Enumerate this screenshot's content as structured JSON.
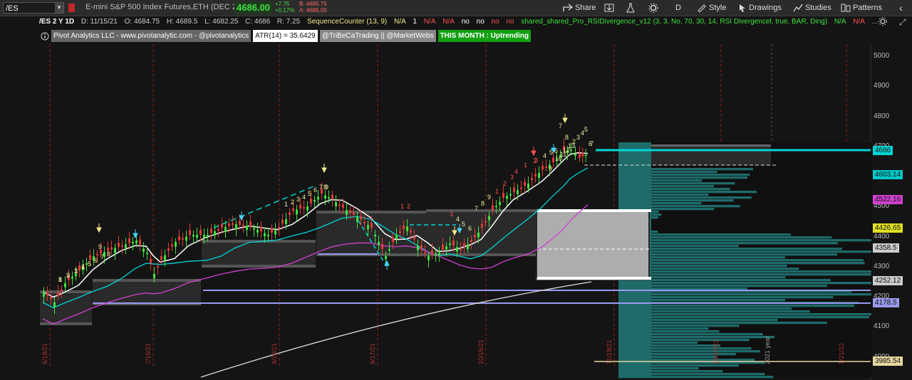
{
  "header": {
    "symbol": "/ES",
    "description": "E-mini S&P 500 Index Futures,ETH (DEC 21)",
    "last": "4686.00",
    "change": "+7.75",
    "change_pct": "+0.17%",
    "bid": "B: 4685.75",
    "ask": "A: 4686.00"
  },
  "toolbar": {
    "share": "Share",
    "period": "D",
    "style": "Style",
    "drawings": "Drawings",
    "studies": "Studies",
    "patterns": "Patterns"
  },
  "studybar": {
    "title": "/ES 2 Y 1D",
    "date": "D: 11/15/21",
    "open": "O: 4684.75",
    "high": "H: 4689.5",
    "low": "L: 4682.25",
    "close": "C: 4686",
    "range": "R: 7.25",
    "seq": "SequenceCounter (13, 9)",
    "na1": "N/A",
    "one": "1",
    "na2": "N/A",
    "na3": "N/A",
    "no1": "no",
    "no2": "no",
    "no3": "no",
    "no4": "no",
    "rsi": "shared_shared_Pro_RSIDivergence_v12 (3, 3, No, 70, 30, 14, RSI Divergencel, true, BAR, Ding)",
    "na4": "N/A",
    "na5": "N/A",
    "more": "..."
  },
  "labels": {
    "pivot": "Pivot Analytics LLC - www.pivotanalytic.com - @pivotanalytics",
    "atr": "ATR(14) = 35.6429",
    "tribeca": "@TriBeCaTrading || @MarketWebs",
    "month": "THIS MONTH : Uptrending"
  },
  "price_axis": [
    "5000",
    "4900",
    "4800",
    "4700",
    "4600",
    "4500",
    "4400",
    "4300",
    "4200",
    "4100",
    "4000"
  ],
  "price_tags": [
    {
      "text": "4686",
      "bg": "#00d4d4"
    },
    {
      "text": "4603.14",
      "bg": "#00c8c8"
    },
    {
      "text": "4522.16",
      "bg": "#d040d0"
    },
    {
      "text": "4426.65",
      "bg": "#e0e020"
    },
    {
      "text": "4358.5",
      "bg": "#cccccc"
    },
    {
      "text": "4252.12",
      "bg": "#cccccc"
    },
    {
      "text": "4178.5",
      "bg": "#9999ee"
    },
    {
      "text": "3985.54",
      "bg": "#e8d8a0"
    }
  ],
  "date_labels": [
    "6/18/21",
    "7/16/21",
    "8/20/21",
    "9/17/21",
    "10/15/21",
    "11/19/21",
    "12/17/21",
    "2021 year",
    "1/21/22"
  ],
  "seq_numbers": [
    "1",
    "2",
    "3",
    "4",
    "5",
    "6",
    "7",
    "8",
    "9",
    "1",
    "2",
    "3",
    "4",
    "5",
    "6",
    "7",
    "8",
    "9",
    "1",
    "2",
    "3",
    "4",
    "5",
    "6",
    "7",
    "8",
    "9",
    "1",
    "2",
    "3",
    "4",
    "1",
    "2",
    "3",
    "4",
    "5",
    "6",
    "7",
    "8",
    "9",
    "10",
    "11",
    "12",
    "13",
    "2",
    "3",
    "4",
    "5",
    "6",
    "7",
    "8",
    "9",
    "1",
    "1"
  ],
  "colors": {
    "bull": "#3ee03e",
    "bear": "#e03a3a",
    "ema_fast": "#ffffff",
    "ema_mid": "#00d4d4",
    "ema_slow": "#d040d0",
    "sma200": "#dddddd",
    "volume_profile": "#1e6b69",
    "sup_line": "#9999ee"
  }
}
